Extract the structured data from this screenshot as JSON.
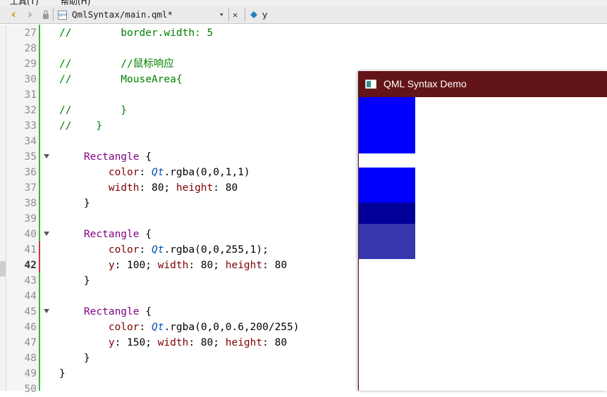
{
  "menubar": {
    "items": [
      "工具(T)",
      "帮助(H)"
    ]
  },
  "toolbar": {
    "back_glyph": "‹",
    "forward_glyph": "›",
    "lock_icon": "lock-icon",
    "file_icon_text": "qml",
    "file_name": "QmlSyntax/main.qml*",
    "dropdown_glyph": "▾",
    "close_glyph": "✕",
    "symbol_name": "y"
  },
  "editor": {
    "current_line": 42,
    "lines": [
      {
        "n": "27",
        "t": "//        border.width: 5"
      },
      {
        "n": "28",
        "t": ""
      },
      {
        "n": "29",
        "t": "//        //鼠标响应"
      },
      {
        "n": "30",
        "t": "//        MouseArea{"
      },
      {
        "n": "31",
        "t": ""
      },
      {
        "n": "32",
        "t": "//        }"
      },
      {
        "n": "33",
        "t": "//    }"
      },
      {
        "n": "34",
        "t": ""
      },
      {
        "n": "35",
        "t": "    Rectangle {"
      },
      {
        "n": "36",
        "t": "        color: Qt.rgba(0,0,1,1)"
      },
      {
        "n": "37",
        "t": "        width: 80; height: 80"
      },
      {
        "n": "38",
        "t": "    }"
      },
      {
        "n": "39",
        "t": ""
      },
      {
        "n": "40",
        "t": "    Rectangle {"
      },
      {
        "n": "41",
        "t": "        color: Qt.rgba(0,0,255,1);"
      },
      {
        "n": "42",
        "t": "        y: 100; width: 80; height: 80"
      },
      {
        "n": "43",
        "t": "    }"
      },
      {
        "n": "44",
        "t": ""
      },
      {
        "n": "45",
        "t": "    Rectangle {"
      },
      {
        "n": "46",
        "t": "        color: Qt.rgba(0,0,0.6,200/255)"
      },
      {
        "n": "47",
        "t": "        y: 150; width: 80; height: 80"
      },
      {
        "n": "48",
        "t": "    }"
      },
      {
        "n": "49",
        "t": "}"
      },
      {
        "n": "50",
        "t": ""
      }
    ]
  },
  "app_window": {
    "title": "QML Syntax Demo",
    "title_bar_color": "#621417",
    "rect_colors": [
      "#0000ff",
      "#0000ff",
      "#000099",
      "#3636ad"
    ]
  }
}
